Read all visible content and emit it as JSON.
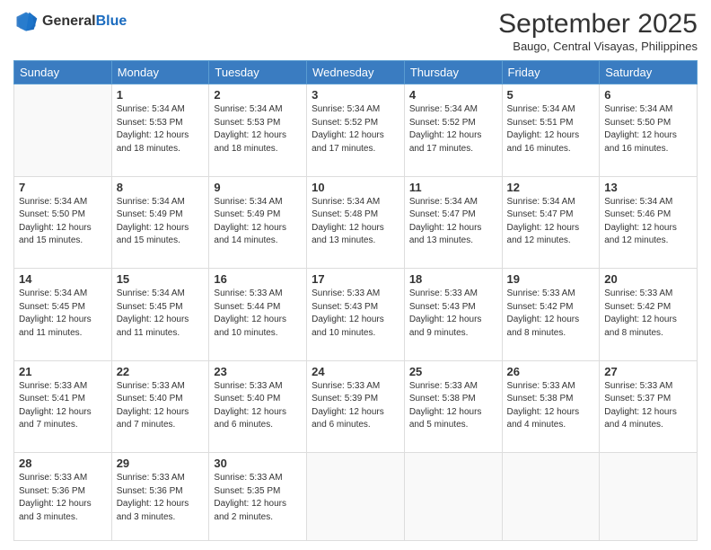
{
  "logo": {
    "general": "General",
    "blue": "Blue"
  },
  "title": "September 2025",
  "location": "Baugo, Central Visayas, Philippines",
  "days_of_week": [
    "Sunday",
    "Monday",
    "Tuesday",
    "Wednesday",
    "Thursday",
    "Friday",
    "Saturday"
  ],
  "weeks": [
    [
      {
        "day": "",
        "info": ""
      },
      {
        "day": "1",
        "info": "Sunrise: 5:34 AM\nSunset: 5:53 PM\nDaylight: 12 hours\nand 18 minutes."
      },
      {
        "day": "2",
        "info": "Sunrise: 5:34 AM\nSunset: 5:53 PM\nDaylight: 12 hours\nand 18 minutes."
      },
      {
        "day": "3",
        "info": "Sunrise: 5:34 AM\nSunset: 5:52 PM\nDaylight: 12 hours\nand 17 minutes."
      },
      {
        "day": "4",
        "info": "Sunrise: 5:34 AM\nSunset: 5:52 PM\nDaylight: 12 hours\nand 17 minutes."
      },
      {
        "day": "5",
        "info": "Sunrise: 5:34 AM\nSunset: 5:51 PM\nDaylight: 12 hours\nand 16 minutes."
      },
      {
        "day": "6",
        "info": "Sunrise: 5:34 AM\nSunset: 5:50 PM\nDaylight: 12 hours\nand 16 minutes."
      }
    ],
    [
      {
        "day": "7",
        "info": "Sunrise: 5:34 AM\nSunset: 5:50 PM\nDaylight: 12 hours\nand 15 minutes."
      },
      {
        "day": "8",
        "info": "Sunrise: 5:34 AM\nSunset: 5:49 PM\nDaylight: 12 hours\nand 15 minutes."
      },
      {
        "day": "9",
        "info": "Sunrise: 5:34 AM\nSunset: 5:49 PM\nDaylight: 12 hours\nand 14 minutes."
      },
      {
        "day": "10",
        "info": "Sunrise: 5:34 AM\nSunset: 5:48 PM\nDaylight: 12 hours\nand 13 minutes."
      },
      {
        "day": "11",
        "info": "Sunrise: 5:34 AM\nSunset: 5:47 PM\nDaylight: 12 hours\nand 13 minutes."
      },
      {
        "day": "12",
        "info": "Sunrise: 5:34 AM\nSunset: 5:47 PM\nDaylight: 12 hours\nand 12 minutes."
      },
      {
        "day": "13",
        "info": "Sunrise: 5:34 AM\nSunset: 5:46 PM\nDaylight: 12 hours\nand 12 minutes."
      }
    ],
    [
      {
        "day": "14",
        "info": "Sunrise: 5:34 AM\nSunset: 5:45 PM\nDaylight: 12 hours\nand 11 minutes."
      },
      {
        "day": "15",
        "info": "Sunrise: 5:34 AM\nSunset: 5:45 PM\nDaylight: 12 hours\nand 11 minutes."
      },
      {
        "day": "16",
        "info": "Sunrise: 5:33 AM\nSunset: 5:44 PM\nDaylight: 12 hours\nand 10 minutes."
      },
      {
        "day": "17",
        "info": "Sunrise: 5:33 AM\nSunset: 5:43 PM\nDaylight: 12 hours\nand 10 minutes."
      },
      {
        "day": "18",
        "info": "Sunrise: 5:33 AM\nSunset: 5:43 PM\nDaylight: 12 hours\nand 9 minutes."
      },
      {
        "day": "19",
        "info": "Sunrise: 5:33 AM\nSunset: 5:42 PM\nDaylight: 12 hours\nand 8 minutes."
      },
      {
        "day": "20",
        "info": "Sunrise: 5:33 AM\nSunset: 5:42 PM\nDaylight: 12 hours\nand 8 minutes."
      }
    ],
    [
      {
        "day": "21",
        "info": "Sunrise: 5:33 AM\nSunset: 5:41 PM\nDaylight: 12 hours\nand 7 minutes."
      },
      {
        "day": "22",
        "info": "Sunrise: 5:33 AM\nSunset: 5:40 PM\nDaylight: 12 hours\nand 7 minutes."
      },
      {
        "day": "23",
        "info": "Sunrise: 5:33 AM\nSunset: 5:40 PM\nDaylight: 12 hours\nand 6 minutes."
      },
      {
        "day": "24",
        "info": "Sunrise: 5:33 AM\nSunset: 5:39 PM\nDaylight: 12 hours\nand 6 minutes."
      },
      {
        "day": "25",
        "info": "Sunrise: 5:33 AM\nSunset: 5:38 PM\nDaylight: 12 hours\nand 5 minutes."
      },
      {
        "day": "26",
        "info": "Sunrise: 5:33 AM\nSunset: 5:38 PM\nDaylight: 12 hours\nand 4 minutes."
      },
      {
        "day": "27",
        "info": "Sunrise: 5:33 AM\nSunset: 5:37 PM\nDaylight: 12 hours\nand 4 minutes."
      }
    ],
    [
      {
        "day": "28",
        "info": "Sunrise: 5:33 AM\nSunset: 5:36 PM\nDaylight: 12 hours\nand 3 minutes."
      },
      {
        "day": "29",
        "info": "Sunrise: 5:33 AM\nSunset: 5:36 PM\nDaylight: 12 hours\nand 3 minutes."
      },
      {
        "day": "30",
        "info": "Sunrise: 5:33 AM\nSunset: 5:35 PM\nDaylight: 12 hours\nand 2 minutes."
      },
      {
        "day": "",
        "info": ""
      },
      {
        "day": "",
        "info": ""
      },
      {
        "day": "",
        "info": ""
      },
      {
        "day": "",
        "info": ""
      }
    ]
  ]
}
